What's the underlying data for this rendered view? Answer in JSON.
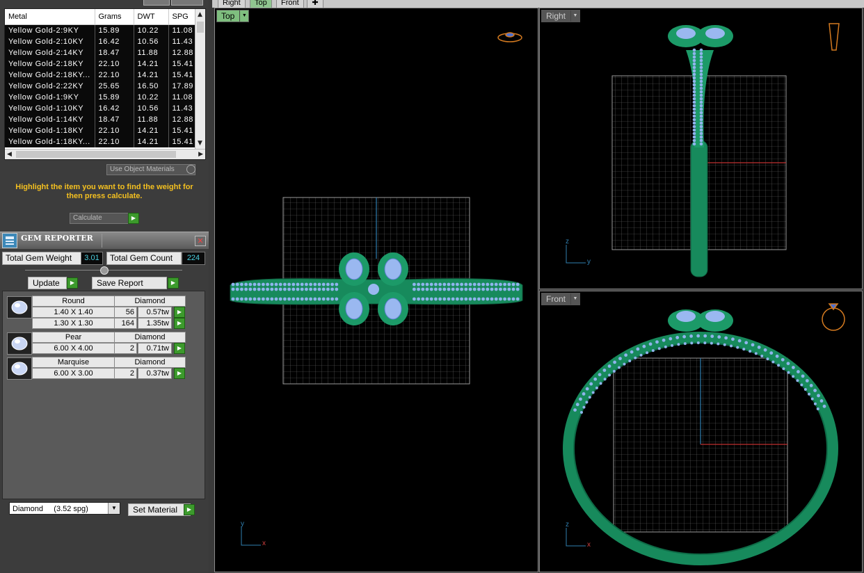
{
  "metal_table": {
    "headers": [
      "Metal",
      "Grams",
      "DWT",
      "SPG"
    ],
    "rows": [
      [
        "Yellow Gold-2:9KY",
        "15.89",
        "10.22",
        "11.08"
      ],
      [
        "Yellow Gold-2:10KY",
        "16.42",
        "10.56",
        "11.43"
      ],
      [
        "Yellow Gold-2:14KY",
        "18.47",
        "11.88",
        "12.88"
      ],
      [
        "Yellow Gold-2:18KY",
        "22.10",
        "14.21",
        "15.41"
      ],
      [
        "Yellow Gold-2:18KY...",
        "22.10",
        "14.21",
        "15.41"
      ],
      [
        "Yellow Gold-2:22KY",
        "25.65",
        "16.50",
        "17.89"
      ],
      [
        "Yellow Gold-1:9KY",
        "15.89",
        "10.22",
        "11.08"
      ],
      [
        "Yellow Gold-1:10KY",
        "16.42",
        "10.56",
        "11.43"
      ],
      [
        "Yellow Gold-1:14KY",
        "18.47",
        "11.88",
        "12.88"
      ],
      [
        "Yellow Gold-1:18KY",
        "22.10",
        "14.21",
        "15.41"
      ],
      [
        "Yellow Gold-1:18KY...",
        "22.10",
        "14.21",
        "15.41"
      ]
    ]
  },
  "use_object_materials_label": "Use Object Materials",
  "hint": "Highlight the item you want to find the weight for then press calculate.",
  "calculate_label": "Calculate",
  "gem_reporter": {
    "title": "GEM REPORTER",
    "total_weight_label": "Total Gem Weight",
    "total_weight_value": "3.01",
    "total_count_label": "Total Gem Count",
    "total_count_value": "224",
    "update_label": "Update",
    "save_report_label": "Save Report",
    "groups": [
      {
        "shape": "Round",
        "material": "Diamond",
        "rows": [
          {
            "size": "1.40 X 1.40",
            "count": "56",
            "weight": "0.57tw"
          },
          {
            "size": "1.30 X 1.30",
            "count": "164",
            "weight": "1.35tw"
          }
        ]
      },
      {
        "shape": "Pear",
        "material": "Diamond",
        "rows": [
          {
            "size": "6.00 X 4.00",
            "count": "2",
            "weight": "0.71tw"
          }
        ]
      },
      {
        "shape": "Marquise",
        "material": "Diamond",
        "rows": [
          {
            "size": "6.00 X 3.00",
            "count": "2",
            "weight": "0.37tw"
          }
        ]
      }
    ],
    "material_select": "Diamond     (3.52 spg)",
    "set_material_label": "Set Material"
  },
  "view_tabs": [
    "Right",
    "Top",
    "Front"
  ],
  "viewports": {
    "top": {
      "label": "Top",
      "axis_a": "y",
      "axis_b": "x"
    },
    "right": {
      "label": "Right",
      "axis_a": "z",
      "axis_b": "y"
    },
    "front": {
      "label": "Front",
      "axis_a": "z",
      "axis_b": "x"
    }
  },
  "colors": {
    "metal_green": "#1f9a6a",
    "gem_blue": "#8fb4ec",
    "accent_yellow": "#f4c020",
    "value_cyan": "#4cd0e0",
    "active_tab_green": "#7fbf7f"
  }
}
